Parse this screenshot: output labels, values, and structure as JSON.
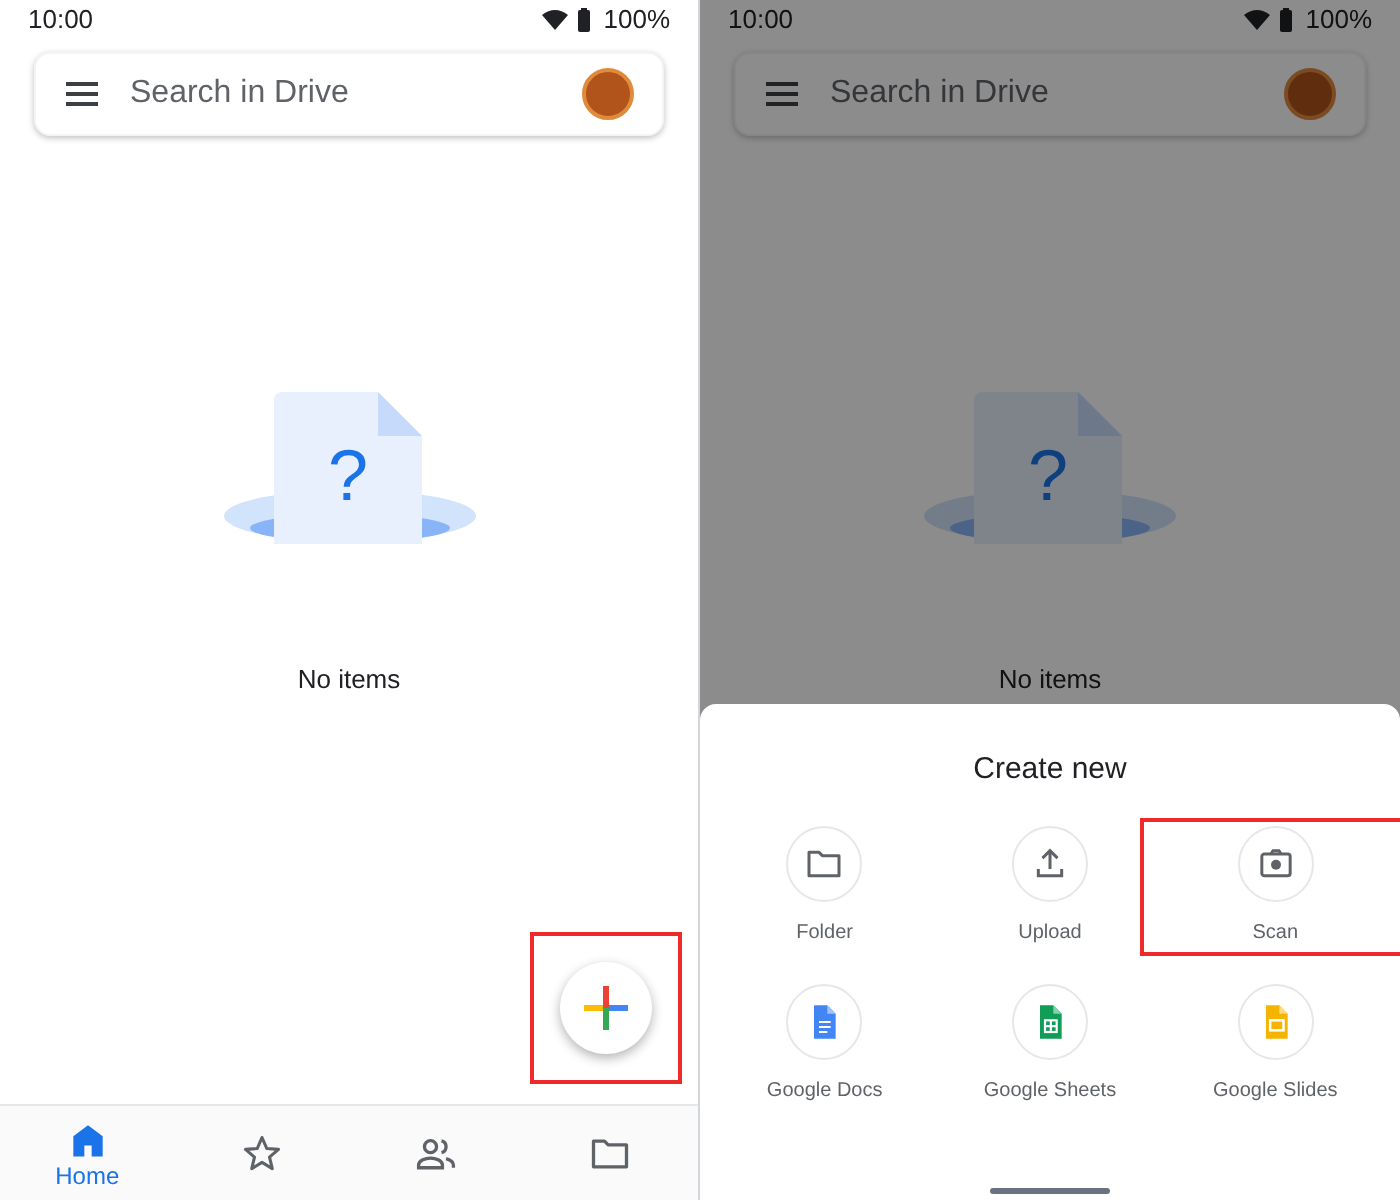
{
  "screens": [
    {
      "status_bar": {
        "time": "10:00",
        "battery": "100%"
      },
      "search": {
        "placeholder": "Search in Drive"
      },
      "empty_state": {
        "mark": "?",
        "message": "No items"
      },
      "fab": {
        "highlighted": true
      },
      "bottom_nav": [
        {
          "kind": "home",
          "label": "Home",
          "selected": true
        },
        {
          "kind": "star",
          "selected": false
        },
        {
          "kind": "people",
          "selected": false
        },
        {
          "kind": "folder",
          "selected": false
        }
      ]
    },
    {
      "dimmed": true,
      "status_bar": {
        "time": "10:00",
        "battery": "100%"
      },
      "search": {
        "placeholder": "Search in Drive"
      },
      "empty_state": {
        "mark": "?",
        "message": "No items"
      },
      "sheet": {
        "title": "Create new",
        "items": [
          {
            "kind": "folder",
            "label": "Folder",
            "highlighted": false
          },
          {
            "kind": "upload",
            "label": "Upload",
            "highlighted": false
          },
          {
            "kind": "scan",
            "label": "Scan",
            "highlighted": true
          },
          {
            "kind": "docs",
            "label": "Google Docs",
            "highlighted": false
          },
          {
            "kind": "sheets",
            "label": "Google Sheets",
            "highlighted": false
          },
          {
            "kind": "slides",
            "label": "Google Slides",
            "highlighted": false
          }
        ]
      }
    }
  ]
}
